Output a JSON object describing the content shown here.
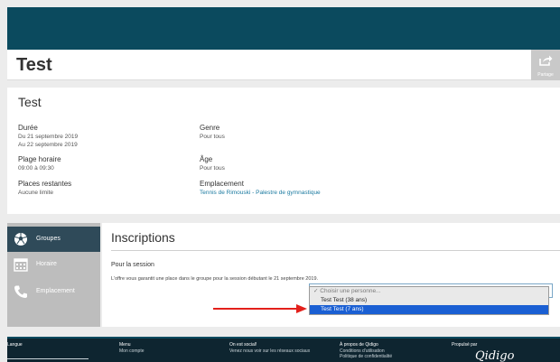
{
  "header": {
    "title": "Test",
    "share_label": "Partage"
  },
  "details": {
    "title": "Test",
    "duration_label": "Durée",
    "duration_from": "Du 21 septembre 2019",
    "duration_to": "Au 22 septembre 2019",
    "schedule_label": "Plage horaire",
    "schedule_value": "09:00 à 09:30",
    "places_label": "Places restantes",
    "places_value": "Aucune limite",
    "gender_label": "Genre",
    "gender_value": "Pour tous",
    "age_label": "Âge",
    "age_value": "Pour tous",
    "location_label": "Emplacement",
    "location_value": "Tennis de Rimouski - Palestre de gymnastique"
  },
  "sidebar": {
    "items": [
      {
        "label": "Groupes",
        "icon": "soccer-ball-icon",
        "active": true
      },
      {
        "label": "Horaire",
        "icon": "calendar-icon",
        "active": false
      },
      {
        "label": "Emplacement",
        "icon": "phone-icon",
        "active": false
      }
    ]
  },
  "inscriptions": {
    "title": "Inscriptions",
    "session_title": "Pour la session",
    "session_text": "L'offre vous garantit une place dans le groupe pour la session débutant le 21 septembre 2019."
  },
  "person_select": {
    "placeholder": "Choisir une personne...",
    "options": [
      "Test Test (38 ans)",
      "Test Test (7 ans)"
    ],
    "highlighted": "Test Test (7 ans)"
  },
  "footer": {
    "language_label": "Langue",
    "menu_title": "Menu",
    "menu_item": "Mon compte",
    "social_title": "On est social!",
    "social_text": "Venez nous voir sur les réseaux sociaux",
    "about_title": "À propos de Qidigo",
    "about_line1": "Conditions d'utilisation",
    "about_line2": "Politique de confidentialité",
    "powered_title": "Propulsé par",
    "logo_text": "Qidigo"
  },
  "colors": {
    "topbar": "#0b4a5e",
    "sidebar_active": "#2f4a59",
    "sidebar": "#bdbdbd",
    "link": "#1b7aa0",
    "selected_option": "#1a5fd3",
    "arrow": "#e3201b",
    "footer": "#0e2530"
  }
}
